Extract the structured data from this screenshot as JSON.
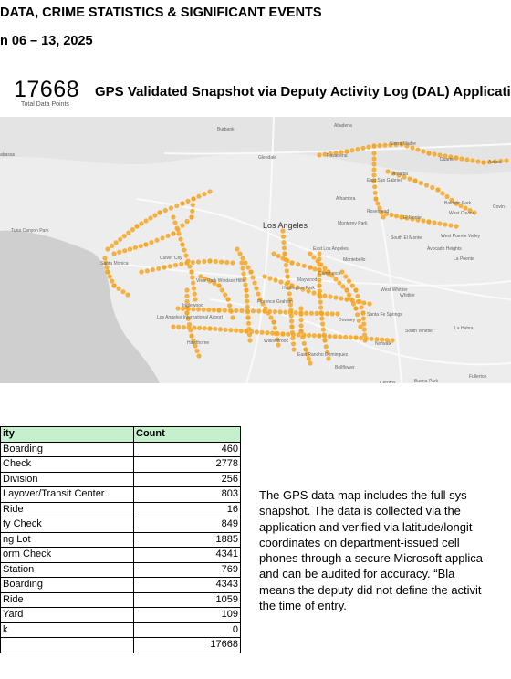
{
  "header": {
    "line1": "DATA, CRIME STATISTICS & SIGNIFICANT EVENTS",
    "line2": "n 06 – 13, 2025"
  },
  "stat": {
    "value": "17668",
    "label": "Total Data Points"
  },
  "map": {
    "title": "GPS Validated Snapshot via Deputy Activity Log (DAL) Application",
    "dot_color": "#f5a623",
    "labels": {
      "burbank": "Burbank",
      "altadena": "Altadena",
      "glendale": "Glendale",
      "pasadena": "Pasadena",
      "sierra_madre": "Sierra Madre",
      "duarte": "Duarte",
      "azusa": "Azusa",
      "arcadia": "Arcadia",
      "calabasas": "abasas",
      "east_san_gabriel": "East San Gabriel",
      "alhambra": "Alhambra",
      "rosemead": "Rosemead",
      "el_monte": "El Monte",
      "baldwin_park": "Baldwin Park",
      "west_covina": "West Covina",
      "covina": "Covin",
      "topanga": "Tuna Canyon Park",
      "los_angeles": "Los Angeles",
      "monterey_park": "Monterey Park",
      "south_el_monte": "South El Monte",
      "west_puente_valley": "West Puente Valley",
      "avocado_heights": "Avocado Heights",
      "la_puente": "La Puente",
      "santa_monica": "Santa Monica",
      "culver_city": "Culver City",
      "east_los_angeles": "East Los Angeles",
      "montebello": "Montebello",
      "commerce": "Commerce",
      "view_park": "View Park Windsor Hills",
      "huntington_park": "Huntington Park",
      "maywood": "Maywood",
      "florence": "Florence Graham",
      "inglewood": "Inglewood",
      "lax": "Los Angeles International Airport",
      "west_whittier": "West Whittier",
      "whittier": "Whittier",
      "santa_fe_springs": "Santa Fe Springs",
      "downey": "Downey",
      "la_habra": "La Habra",
      "hawthorne": "Hawthorne",
      "willowbrook": "Willowbrook",
      "norwalk": "Norwalk",
      "south_whittier": "South Whittier",
      "east_rancho": "East Rancho Dominguez",
      "bellflower": "Bellflower",
      "fullerton": "Fullerton",
      "cerritos": "Cerritos",
      "buena_park": "Buena Park"
    }
  },
  "table": {
    "headers": [
      "ity",
      "Count"
    ],
    "rows": [
      [
        "Boarding",
        "460"
      ],
      [
        "Check",
        "2778"
      ],
      [
        "Division",
        "256"
      ],
      [
        "Layover/Transit Center",
        "803"
      ],
      [
        "Ride",
        "16"
      ],
      [
        "ty Check",
        "849"
      ],
      [
        "ng Lot",
        "1885"
      ],
      [
        "orm Check",
        "4341"
      ],
      [
        "Station",
        "769"
      ],
      [
        "Boarding",
        "4343"
      ],
      [
        "Ride",
        "1059"
      ],
      [
        "Yard",
        "109"
      ],
      [
        "k",
        "0"
      ],
      [
        "",
        "17668"
      ]
    ]
  },
  "paragraph": [
    "The GPS data map includes the full sys",
    "snapshot. The data is collected via the",
    "application and verified via latitude/longit",
    "coordinates on department-issued cell",
    "phones through a secure Microsoft applica",
    "and can be audited for accuracy. “Bla",
    "means the deputy did not define the activit",
    "the time of entry."
  ]
}
